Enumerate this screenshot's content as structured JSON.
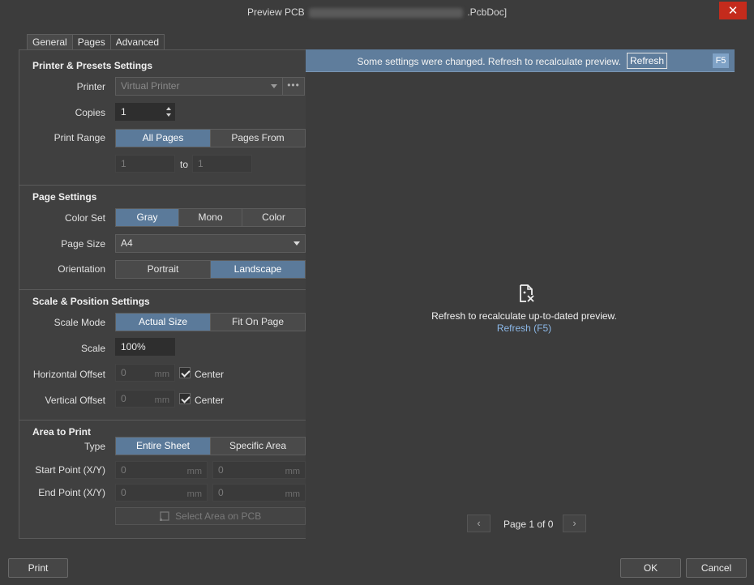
{
  "window": {
    "title_prefix": "Preview PCB",
    "title_suffix": ".PcbDoc]",
    "close_glyph": "✕"
  },
  "tabs": [
    {
      "label": "General",
      "active": true
    },
    {
      "label": "Pages",
      "active": false
    },
    {
      "label": "Advanced",
      "active": false
    }
  ],
  "printer_section": {
    "title": "Printer & Presets Settings",
    "printer_label": "Printer",
    "printer_value": "Virtual Printer",
    "ellipsis": "•••",
    "copies_label": "Copies",
    "copies_value": "1",
    "print_range_label": "Print Range",
    "print_range_options": [
      "All Pages",
      "Pages From"
    ],
    "print_range_selected": "All Pages",
    "range_from": "1",
    "range_to_label": "to",
    "range_to": "1"
  },
  "page_section": {
    "title": "Page Settings",
    "color_set_label": "Color Set",
    "color_set_options": [
      "Gray",
      "Mono",
      "Color"
    ],
    "color_set_selected": "Gray",
    "page_size_label": "Page Size",
    "page_size_value": "A4",
    "orientation_label": "Orientation",
    "orientation_options": [
      "Portrait",
      "Landscape"
    ],
    "orientation_selected": "Landscape"
  },
  "scale_section": {
    "title": "Scale & Position Settings",
    "scale_mode_label": "Scale Mode",
    "scale_mode_options": [
      "Actual Size",
      "Fit On Page"
    ],
    "scale_mode_selected": "Actual Size",
    "scale_label": "Scale",
    "scale_value": "100%",
    "h_offset_label": "Horizontal Offset",
    "h_offset_value": "0",
    "h_offset_unit": "mm",
    "h_center_label": "Center",
    "v_offset_label": "Vertical Offset",
    "v_offset_value": "0",
    "v_offset_unit": "mm",
    "v_center_label": "Center"
  },
  "area_section": {
    "title": "Area to Print",
    "type_label": "Type",
    "type_options": [
      "Entire Sheet",
      "Specific Area"
    ],
    "type_selected": "Entire Sheet",
    "start_label": "Start Point (X/Y)",
    "start_x": "0",
    "start_y": "0",
    "end_label": "End Point (X/Y)",
    "end_x": "0",
    "end_y": "0",
    "unit": "mm",
    "select_area_label": "Select Area on PCB"
  },
  "preview": {
    "banner_text": "Some settings were changed. Refresh to recalculate preview.",
    "banner_button": "Refresh",
    "banner_shortcut": "F5",
    "message": "Refresh to recalculate up-to-dated preview.",
    "link": "Refresh (F5)",
    "page_indicator": "Page 1 of 0",
    "prev_glyph": "‹",
    "next_glyph": "›"
  },
  "footer": {
    "print_label": "Print",
    "ok_label": "OK",
    "cancel_label": "Cancel"
  },
  "colors": {
    "background": "#3c3c3c",
    "panel": "#404040",
    "accent_selected": "#5b7a9a",
    "banner": "#5f7d9c",
    "link": "#8cb8e8",
    "close": "#c42b1c"
  }
}
